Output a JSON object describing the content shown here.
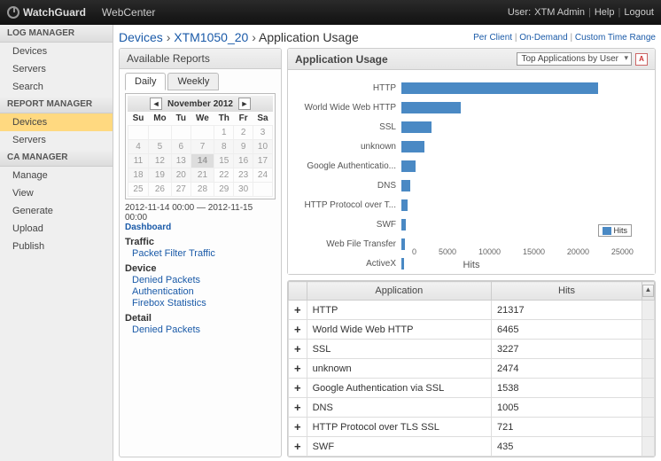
{
  "topbar": {
    "brand": "WatchGuard",
    "app": "WebCenter",
    "user_label": "User:",
    "user": "XTM Admin",
    "help": "Help",
    "logout": "Logout"
  },
  "sidebar": {
    "sections": [
      {
        "title": "LOG MANAGER",
        "items": [
          "Devices",
          "Servers",
          "Search"
        ],
        "active": null
      },
      {
        "title": "REPORT MANAGER",
        "items": [
          "Devices",
          "Servers"
        ],
        "active": "Devices"
      },
      {
        "title": "CA MANAGER",
        "items": [
          "Manage",
          "View",
          "Generate",
          "Upload",
          "Publish"
        ],
        "active": null
      }
    ]
  },
  "breadcrumb": {
    "root": "Devices",
    "mid": "XTM1050_20",
    "last": "Application Usage"
  },
  "top_links": {
    "per_client": "Per Client",
    "on_demand": "On-Demand",
    "custom_range": "Custom Time Range"
  },
  "avail_panel": {
    "title": "Available Reports",
    "tabs": {
      "daily": "Daily",
      "weekly": "Weekly",
      "active": "Daily"
    }
  },
  "calendar": {
    "title": "November 2012",
    "dow": [
      "Su",
      "Mo",
      "Tu",
      "We",
      "Th",
      "Fr",
      "Sa"
    ],
    "range_text": "2012-11-14 00:00 — 2012-11-15 00:00",
    "dash": "Dashboard"
  },
  "report_links": {
    "traffic": {
      "h": "Traffic",
      "items": [
        "Packet Filter Traffic"
      ]
    },
    "device": {
      "h": "Device",
      "items": [
        "Denied Packets",
        "Authentication",
        "Firebox Statistics"
      ]
    },
    "detail": {
      "h": "Detail",
      "items": [
        "Denied Packets"
      ]
    }
  },
  "chart_panel": {
    "title": "Application Usage",
    "selector": "Top Applications by User",
    "pdf": "PDF"
  },
  "chart_data": {
    "type": "bar",
    "orientation": "horizontal",
    "xlabel": "Hits",
    "xlim": [
      0,
      25000
    ],
    "ticks": [
      0,
      5000,
      10000,
      15000,
      20000,
      25000
    ],
    "legend": [
      "Hits"
    ],
    "categories": [
      "HTTP",
      "World Wide Web HTTP",
      "SSL",
      "unknown",
      "Google Authenticatio...",
      "DNS",
      "HTTP Protocol over T...",
      "SWF",
      "Web File Transfer",
      "ActiveX"
    ],
    "values": [
      21317,
      6465,
      3227,
      2474,
      1538,
      1005,
      721,
      435,
      350,
      250
    ]
  },
  "table": {
    "headers": [
      "Application",
      "Hits"
    ],
    "rows": [
      {
        "app": "HTTP",
        "hits": "21317"
      },
      {
        "app": "World Wide Web HTTP",
        "hits": "6465"
      },
      {
        "app": "SSL",
        "hits": "3227"
      },
      {
        "app": "unknown",
        "hits": "2474"
      },
      {
        "app": "Google Authentication via SSL",
        "hits": "1538"
      },
      {
        "app": "DNS",
        "hits": "1005"
      },
      {
        "app": "HTTP Protocol over TLS SSL",
        "hits": "721"
      },
      {
        "app": "SWF",
        "hits": "435"
      }
    ]
  }
}
